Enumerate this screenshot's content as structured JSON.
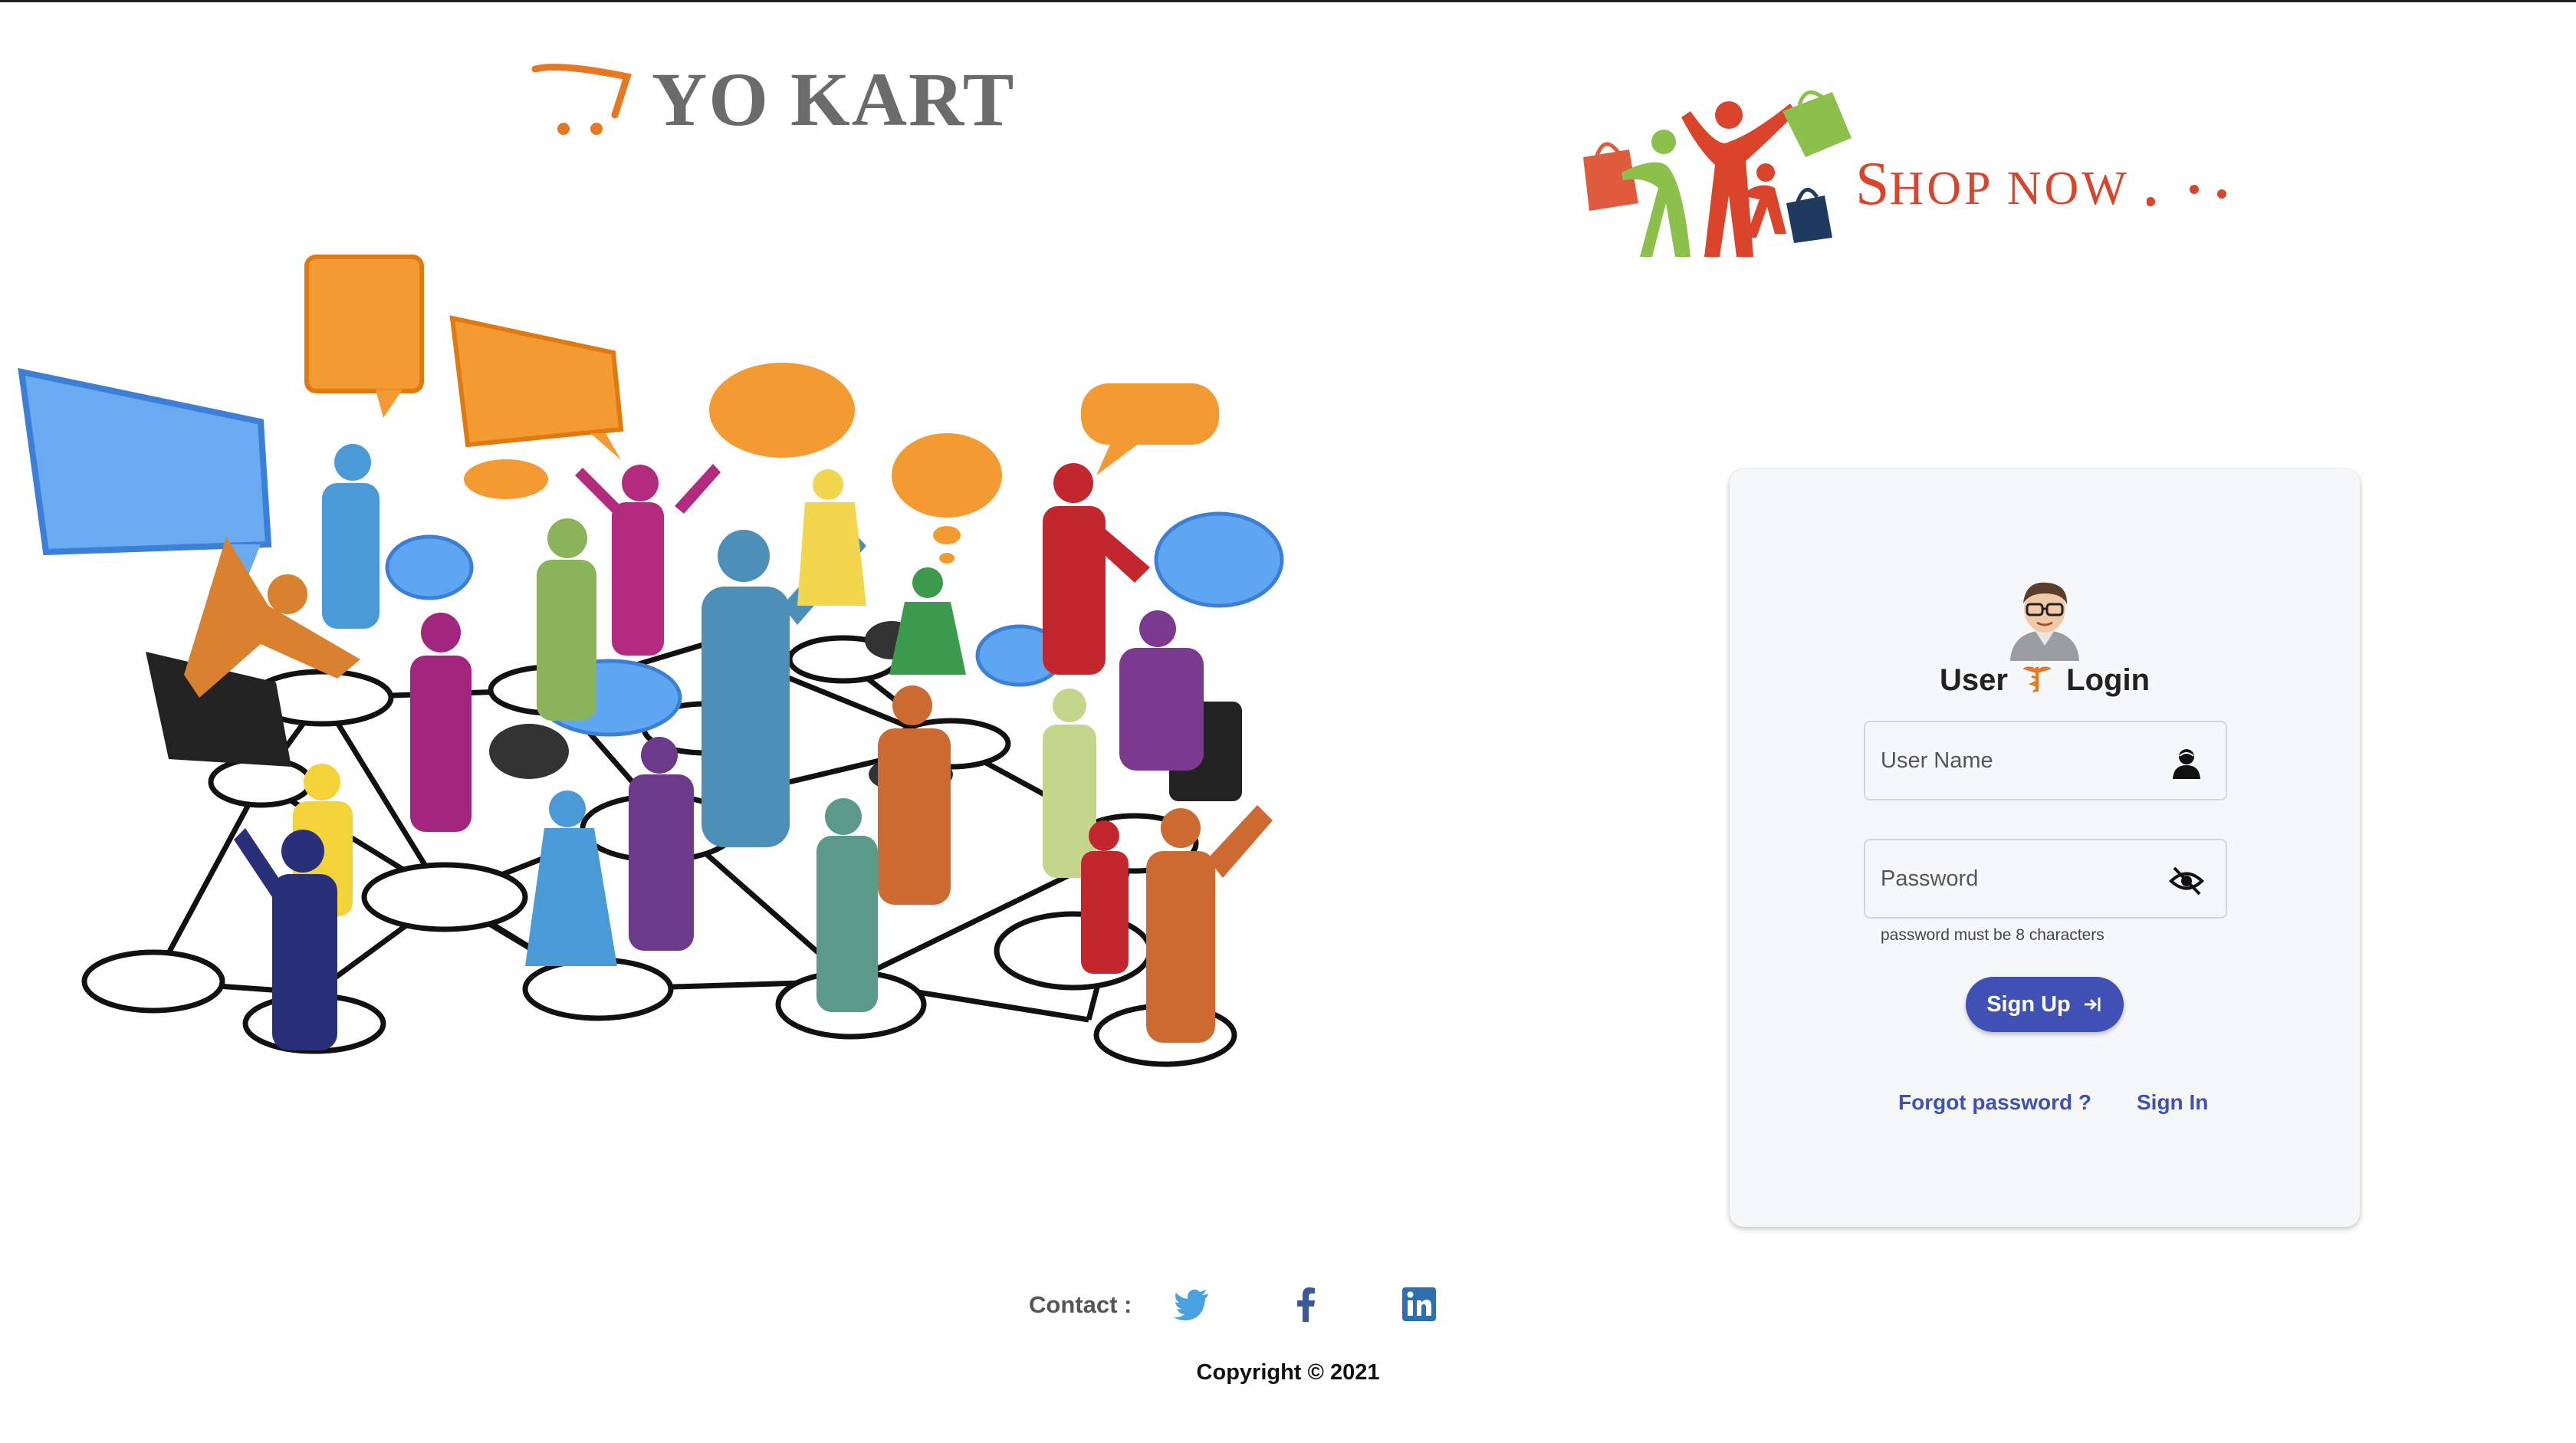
{
  "brand": {
    "name": "YO KART",
    "logo_icon": "cart-icon"
  },
  "shop_now": {
    "first_letter": "S",
    "rest": "HOP  NOW",
    "art_icon": "shopping-people-bags-icon"
  },
  "illustration": {
    "icon": "social-network-people-icon"
  },
  "login": {
    "title_left": "User",
    "title_right": "Login",
    "avatar_icon": "user-avatar-icon",
    "title_icon": "caduceus-icon",
    "username_placeholder": "User Name",
    "username_icon": "user-icon",
    "password_placeholder": "Password",
    "password_icon": "eye-off-icon",
    "helper": "password must be 8 characters",
    "signup_label": "Sign Up",
    "signup_icon": "login-arrow-icon",
    "forgot_label": "Forgot password ?",
    "signin_label": "Sign In"
  },
  "footer": {
    "contact_label": "Contact :",
    "social": [
      "twitter-icon",
      "facebook-icon",
      "linkedin-icon"
    ],
    "copyright": "Copyright  © 2021"
  },
  "colors": {
    "accent": "#3f51b5",
    "brand_gray": "#6b6b6b",
    "shop_red": "#d9442a",
    "cart_orange": "#e87722",
    "card_bg": "#f6f7f9"
  }
}
